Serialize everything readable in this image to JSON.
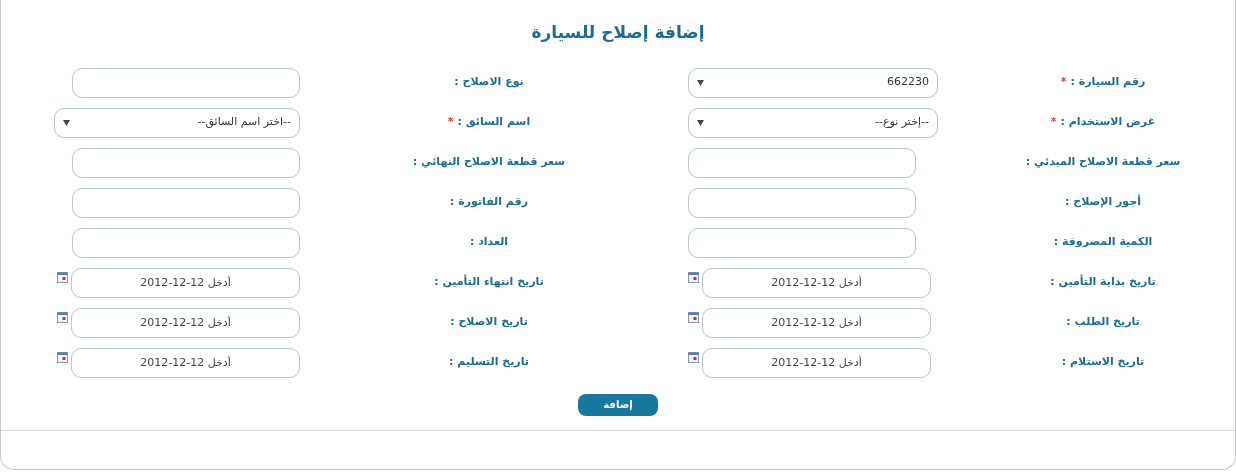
{
  "title": "إضافة إصلاح للسيارة",
  "rows": [
    [
      {
        "label": "رقم السيارة :",
        "required": true,
        "kind": "select",
        "value": "662230"
      },
      {
        "label": "نوع الاصلاح :",
        "required": false,
        "kind": "text"
      }
    ],
    [
      {
        "label": "غرض الاستخدام :",
        "required": true,
        "kind": "select",
        "value": "--إختر نوع--"
      },
      {
        "label": "اسم السائق :",
        "required": true,
        "kind": "select",
        "value": "--اختر اسم السائق--"
      }
    ],
    [
      {
        "label": "سعر قطعة الاصلاح المبدئي :",
        "required": false,
        "kind": "text"
      },
      {
        "label": "سعر قطعة الاصلاح النهائي :",
        "required": false,
        "kind": "text"
      }
    ],
    [
      {
        "label": "أجور الإصلاح :",
        "required": false,
        "kind": "text"
      },
      {
        "label": "رقم الفاتورة :",
        "required": false,
        "kind": "text"
      }
    ],
    [
      {
        "label": "الكمية المصروفة :",
        "required": false,
        "kind": "text"
      },
      {
        "label": "العداد :",
        "required": false,
        "kind": "text"
      }
    ],
    [
      {
        "label": "تاريخ بداية التأمين :",
        "required": false,
        "kind": "date",
        "placeholder": "أدخل 12-12-2012"
      },
      {
        "label": "تاريخ انتهاء التأمين :",
        "required": false,
        "kind": "date",
        "placeholder": "أدخل 12-12-2012"
      }
    ],
    [
      {
        "label": "تاريخ الطلب :",
        "required": false,
        "kind": "date",
        "placeholder": "أدخل 12-12-2012"
      },
      {
        "label": "تاريخ الاصلاح :",
        "required": false,
        "kind": "date",
        "placeholder": "أدخل 12-12-2012"
      }
    ],
    [
      {
        "label": "تاريخ الاستلام :",
        "required": false,
        "kind": "date",
        "placeholder": "أدخل 12-12-2012"
      },
      {
        "label": "تاريخ التسليم :",
        "required": false,
        "kind": "date",
        "placeholder": "أدخل 12-12-2012"
      }
    ]
  ],
  "required_symbol": "*",
  "submit": "إضافة"
}
